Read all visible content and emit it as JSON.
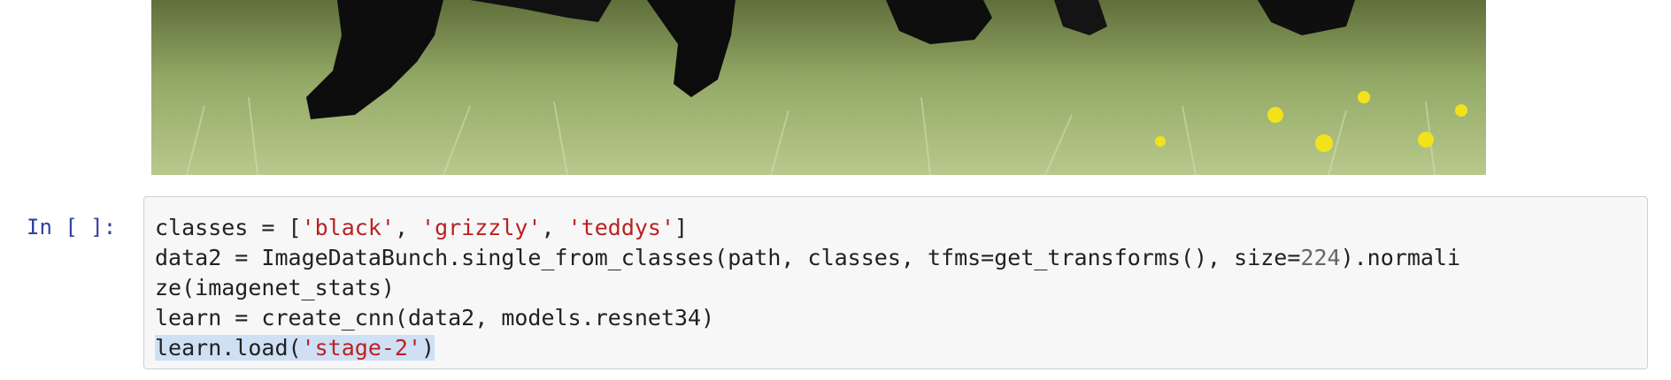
{
  "cell": {
    "prompt": "In [ ]:",
    "lines": [
      {
        "parts": [
          {
            "t": "classes = [",
            "c": "plain"
          },
          {
            "t": "'black'",
            "c": "str"
          },
          {
            "t": ", ",
            "c": "plain"
          },
          {
            "t": "'grizzly'",
            "c": "str"
          },
          {
            "t": ", ",
            "c": "plain"
          },
          {
            "t": "'teddys'",
            "c": "str"
          },
          {
            "t": "]",
            "c": "plain"
          }
        ]
      },
      {
        "parts": [
          {
            "t": "data2 = ImageDataBunch.single_from_classes(path, classes, tfms=get_transforms(), size=",
            "c": "plain"
          },
          {
            "t": "224",
            "c": "num"
          },
          {
            "t": ").normali",
            "c": "plain"
          }
        ]
      },
      {
        "parts": [
          {
            "t": "ze(imagenet_stats)",
            "c": "plain"
          }
        ]
      },
      {
        "parts": [
          {
            "t": "learn = create_cnn(data2, models.resnet34)",
            "c": "plain"
          }
        ]
      },
      {
        "parts": [
          {
            "t": "learn.load(",
            "c": "plain sel"
          },
          {
            "t": "'stage-2'",
            "c": "str sel"
          },
          {
            "t": ")",
            "c": "plain sel"
          }
        ]
      }
    ]
  },
  "colors": {
    "prompt": "#303f9f",
    "string": "#ba2121",
    "number": "#666666",
    "selection": "#cfe0f5",
    "cell_background": "#f7f7f7",
    "cell_border": "#cfcfcf"
  }
}
